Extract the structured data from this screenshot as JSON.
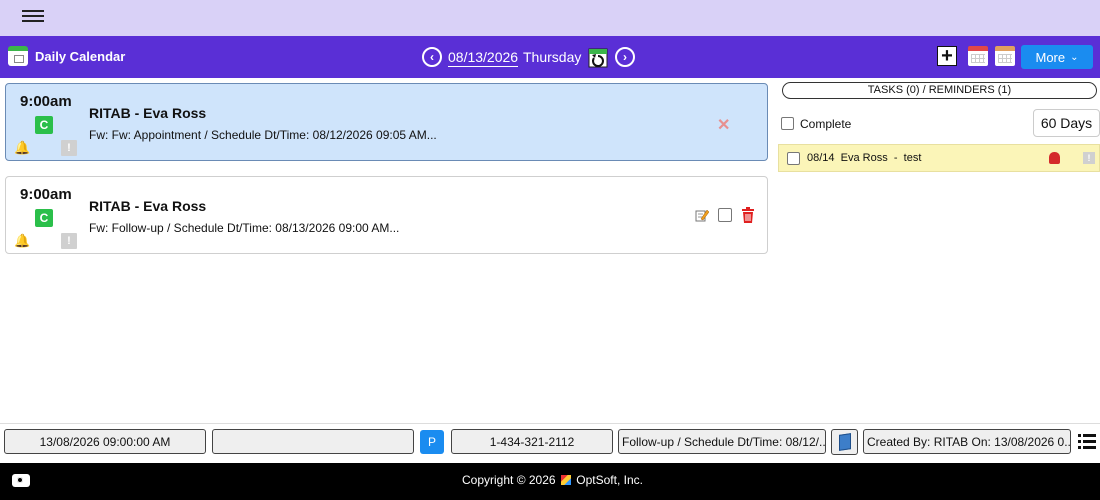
{
  "header": {
    "menu_icon": "hamburger-icon",
    "title": "Daily Calendar",
    "date": "08/13/2026",
    "day": "Thursday",
    "more_label": "More",
    "colors": {
      "topbar": "#d9d1f7",
      "navbar": "#5a2fd6",
      "accent": "#1a8cf0"
    }
  },
  "appointments": [
    {
      "time": "9:00am",
      "status": "C",
      "title": "RITAB - Eva Ross",
      "description": "Fw: Fw: Appointment / Schedule Dt/Time: 08/12/2026 09:05 AM...",
      "selected": true
    },
    {
      "time": "9:00am",
      "status": "C",
      "title": "RITAB - Eva Ross",
      "description": "Fw: Follow-up / Schedule Dt/Time: 08/13/2026 09:00 AM...",
      "selected": false
    }
  ],
  "right_panel": {
    "header": "TASKS (0) / REMINDERS (1)",
    "complete_label": "Complete",
    "days_label": "60 Days",
    "reminders": [
      {
        "date": "08/14",
        "name": "Eva Ross",
        "separator": "-",
        "note": "test"
      }
    ]
  },
  "statusbar": {
    "datetime": "13/08/2026 09:00:00 AM",
    "blank": "",
    "p_label": "P",
    "phone": "1-434-321-2112",
    "subject": "Follow-up / Schedule Dt/Time: 08/12/...",
    "created": "Created By: RITAB On: 13/08/2026 0..."
  },
  "footer": {
    "copyright": "Copyright © 2026",
    "company": "OptSoft, Inc."
  }
}
